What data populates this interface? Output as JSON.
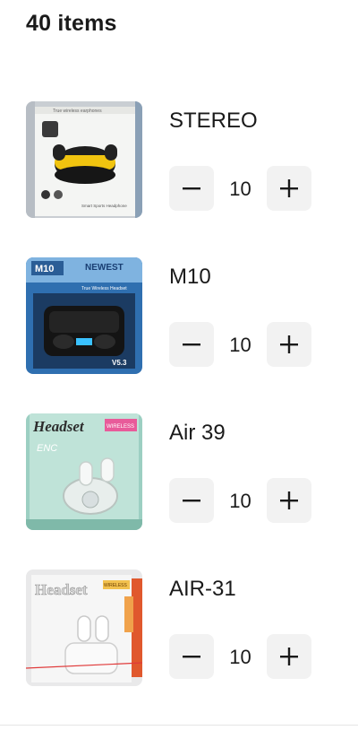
{
  "header": {
    "title": "40 items"
  },
  "items": [
    {
      "name": "STEREO",
      "quantity": "10",
      "minus_icon": "minus-icon",
      "plus_icon": "plus-icon",
      "image_text": [
        "True wireless earphones",
        "Smart Sports Headphone"
      ]
    },
    {
      "name": "M10",
      "quantity": "10",
      "minus_icon": "minus-icon",
      "plus_icon": "plus-icon",
      "image_text": [
        "M10",
        "NEWEST",
        "True Wireless Headset",
        "V5.3"
      ]
    },
    {
      "name": "Air 39",
      "quantity": "10",
      "minus_icon": "minus-icon",
      "plus_icon": "plus-icon",
      "image_text": [
        "Headset",
        "WIRELESS",
        "ENC"
      ]
    },
    {
      "name": "AIR-31",
      "quantity": "10",
      "minus_icon": "minus-icon",
      "plus_icon": "plus-icon",
      "image_text": [
        "Headset",
        "WIRELESS"
      ]
    }
  ],
  "colors": {
    "button_bg": "#f2f2f2",
    "text": "#1a1a1a",
    "divider": "#e6e6e6"
  }
}
